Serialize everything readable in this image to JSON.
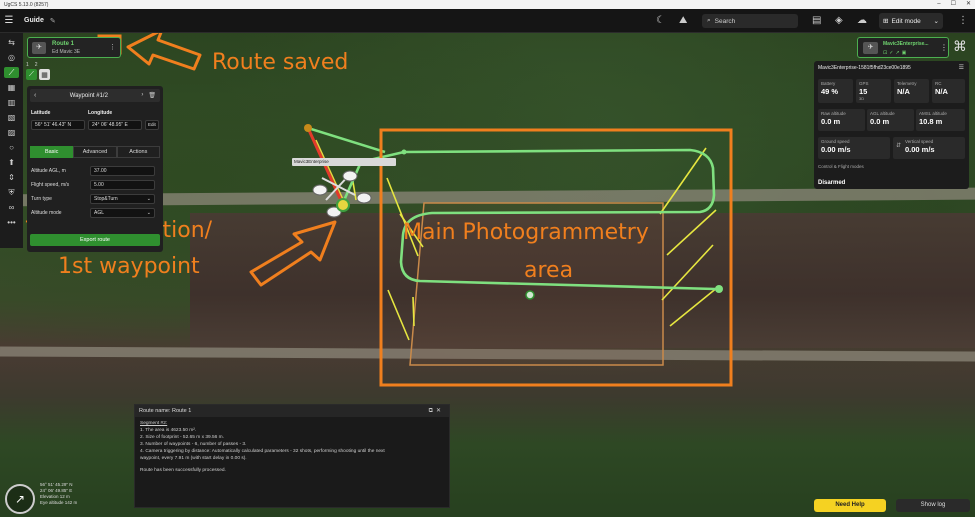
{
  "window": {
    "title": "UgCS 5.13.0 (8257)",
    "controls": [
      "–",
      "☐",
      "✕"
    ]
  },
  "header": {
    "menu_icon": "hamburger-icon",
    "title": "Guide",
    "search_placeholder": "Search",
    "mode_label": "Edit mode"
  },
  "route_card": {
    "name": "Route 1",
    "vehicle": "Ed Mavic 3E"
  },
  "route_steps": [
    "1",
    "2"
  ],
  "waypoint": {
    "title": "Waypoint #1/2",
    "latitude_label": "Latitude",
    "longitude_label": "Longitude",
    "latitude": "56° 51' 46.43\" N",
    "longitude": "24° 06' 48.95\" E",
    "edit_label": "Edit",
    "tabs": [
      "Basic",
      "Advanced",
      "Actions"
    ],
    "fields": [
      {
        "label": "Altitude AGL, m",
        "value": "37.00"
      },
      {
        "label": "Flight speed, m/s",
        "value": "5.00"
      },
      {
        "label": "Turn type",
        "value": "Stop&Turn"
      },
      {
        "label": "Altitude mode",
        "value": "AGL"
      }
    ],
    "export_label": "Export route"
  },
  "drone_card": {
    "name": "Mavic3Enterprise..."
  },
  "telemetry": {
    "title": "Mavic3Enterprise-1581f5fhd23ce00e1895",
    "boxes": [
      {
        "label": "Battery",
        "value": "49 %",
        "sub": ""
      },
      {
        "label": "GPS",
        "value": "15",
        "sub": "3D"
      },
      {
        "label": "Telemetry",
        "value": "N/A",
        "sub": ""
      },
      {
        "label": "RC",
        "value": "N/A",
        "sub": ""
      },
      {
        "label": "Raw altitude",
        "value": "0.0 m",
        "sub": ""
      },
      {
        "label": "AGL altitude",
        "value": "0.0 m",
        "sub": ""
      },
      {
        "label": "AMSL altitude",
        "value": "10.8 m",
        "sub": ""
      },
      {
        "label": "Ground speed",
        "value": "0.00 m/s",
        "sub": ""
      },
      {
        "label": "Vertical speed",
        "value": "0.00 m/s",
        "sub": ""
      }
    ],
    "sub_label": "Control & Flight modes",
    "status": "Disarmed"
  },
  "map": {
    "drone_tag": "Mavic3Enterprise"
  },
  "log": {
    "title": "Route name: Route 1",
    "segment": "Segment #2:",
    "lines": [
      "1. The area is 4623.50 m².",
      "2. Size of footprint - 52.65 m x 39.56 m.",
      "3. Number of waypoints - 6, number of passes - 3.",
      "4. Camera triggering by distance: Automatically calculated parameters - 32 shots, performing shooting until the next",
      "waypoint, every 7.91 m (with start delay in 0.00 s)."
    ],
    "result": "Route has been successfully processed."
  },
  "bottom": {
    "need_help": "Need Help",
    "show_log": "Show log"
  },
  "status_coords": {
    "lat": "56° 51' 45.29\" N",
    "lon": "24° 06' 49.85\" E",
    "elevation": "Elevation 12 m",
    "eye_altitude": "Eye altitude 142 m"
  },
  "annotations": {
    "route_saved": "Route saved",
    "takeoff_line1": "Take off location/",
    "takeoff_line2": "1st waypoint",
    "area_line1": "Main Photogrammetry",
    "area_line2": "area"
  },
  "colors": {
    "accent_green": "#2f8f2f",
    "annotation_orange": "#f07f1e",
    "route_line": "#7fe07f",
    "help_yellow": "#f5d222"
  }
}
